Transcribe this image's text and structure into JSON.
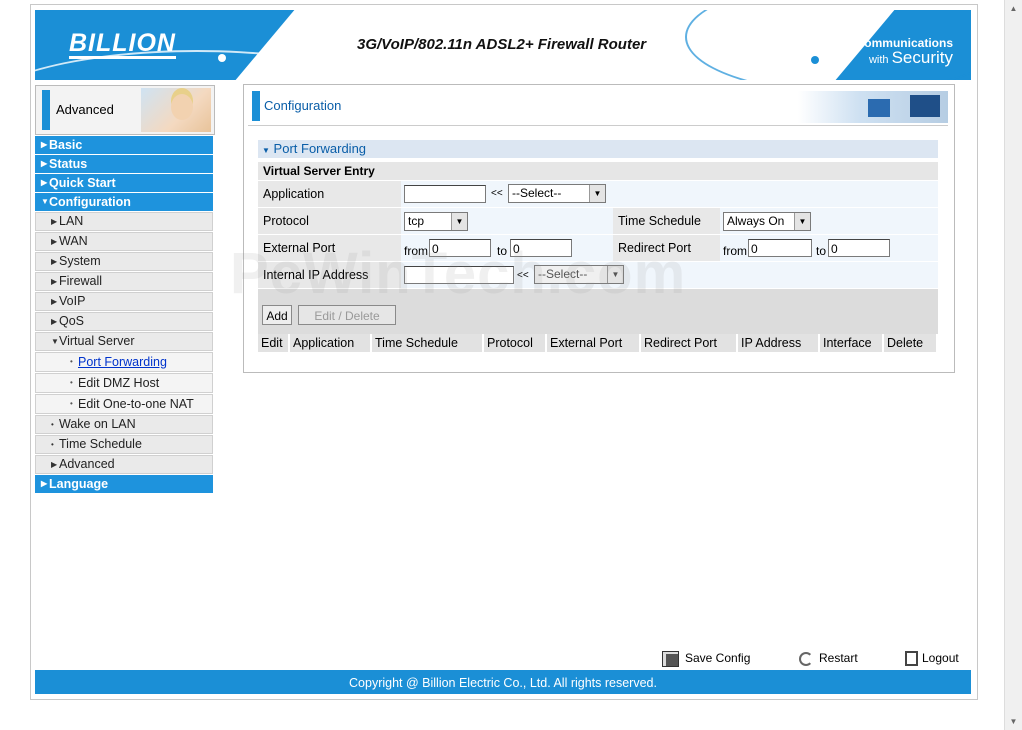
{
  "header": {
    "logo": "BILLION",
    "title": "3G/VoIP/802.11n ADSL2+ Firewall Router",
    "slogan_line1": "Powering communications",
    "slogan_line2_small": "with",
    "slogan_line2_big": "Security"
  },
  "sidebar": {
    "mode_label": "Advanced",
    "items": [
      {
        "label": "Basic",
        "level": "top"
      },
      {
        "label": "Status",
        "level": "top"
      },
      {
        "label": "Quick Start",
        "level": "top"
      },
      {
        "label": "Configuration",
        "level": "top",
        "expanded": true
      },
      {
        "label": "LAN",
        "level": "sub"
      },
      {
        "label": "WAN",
        "level": "sub"
      },
      {
        "label": "System",
        "level": "sub"
      },
      {
        "label": "Firewall",
        "level": "sub"
      },
      {
        "label": "VoIP",
        "level": "sub"
      },
      {
        "label": "QoS",
        "level": "sub"
      },
      {
        "label": "Virtual Server",
        "level": "sub",
        "expanded": true
      },
      {
        "label": "Port Forwarding",
        "level": "sub2",
        "selected": true
      },
      {
        "label": "Edit DMZ Host",
        "level": "sub2"
      },
      {
        "label": "Edit One-to-one NAT",
        "level": "sub2"
      },
      {
        "label": "Wake on LAN",
        "level": "sub"
      },
      {
        "label": "Time Schedule",
        "level": "sub"
      },
      {
        "label": "Advanced",
        "level": "sub"
      },
      {
        "label": "Language",
        "level": "top"
      }
    ]
  },
  "page": {
    "title": "Configuration",
    "section_title": "Port Forwarding",
    "entry_title": "Virtual Server Entry"
  },
  "form": {
    "application_label": "Application",
    "application_value": "",
    "arrow_text": "<<",
    "application_select": "--Select--",
    "protocol_label": "Protocol",
    "protocol_value": "tcp",
    "time_schedule_label": "Time Schedule",
    "time_schedule_value": "Always On",
    "external_port_label": "External Port",
    "from_label": "from",
    "to_label": "to",
    "external_from": "0",
    "external_to": "0",
    "redirect_port_label": "Redirect Port",
    "redirect_from": "0",
    "redirect_to": "0",
    "ip_label": "Internal IP Address",
    "ip_value": "",
    "ip_select": "--Select--",
    "add_label": "Add",
    "edit_delete_label": "Edit / Delete"
  },
  "table": {
    "columns": [
      "Edit",
      "Application",
      "Time Schedule",
      "Protocol",
      "External Port",
      "Redirect Port",
      "IP Address",
      "Interface",
      "Delete"
    ]
  },
  "actions": {
    "save": "Save Config",
    "restart": "Restart",
    "logout": "Logout"
  },
  "footer": {
    "copyright": "Copyright @ Billion Electric Co., Ltd. All rights reserved."
  },
  "watermark": "PcWinTech.com",
  "colors": {
    "brand_blue": "#1b8fd6",
    "link": "#0033cc"
  }
}
